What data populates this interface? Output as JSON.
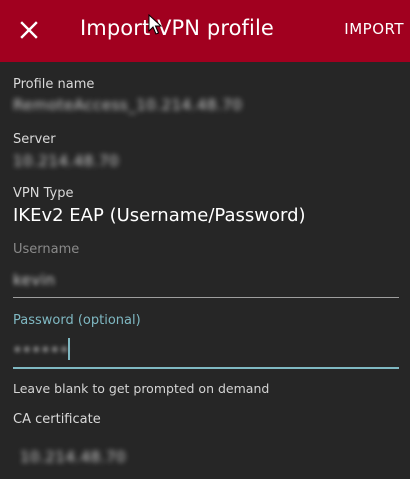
{
  "app_bar": {
    "title": "Import VPN profile",
    "action_label": "IMPORT",
    "close_icon": "close-icon",
    "color": "#a1001f"
  },
  "form": {
    "profile_name": {
      "label": "Profile name",
      "value": "RemoteAccess_10.214.48.70"
    },
    "server": {
      "label": "Server",
      "value": "10.214.48.70"
    },
    "vpn_type": {
      "label": "VPN Type",
      "value": "IKEv2 EAP (Username/Password)"
    },
    "username": {
      "label": "Username",
      "value": "kevin"
    },
    "password": {
      "label": "Password (optional)",
      "value": "••••••",
      "helper": "Leave blank to get prompted on demand",
      "focus_color": "#7fb8c2"
    },
    "ca_certificate": {
      "label": "CA certificate",
      "value": "10.214.48.70"
    }
  }
}
